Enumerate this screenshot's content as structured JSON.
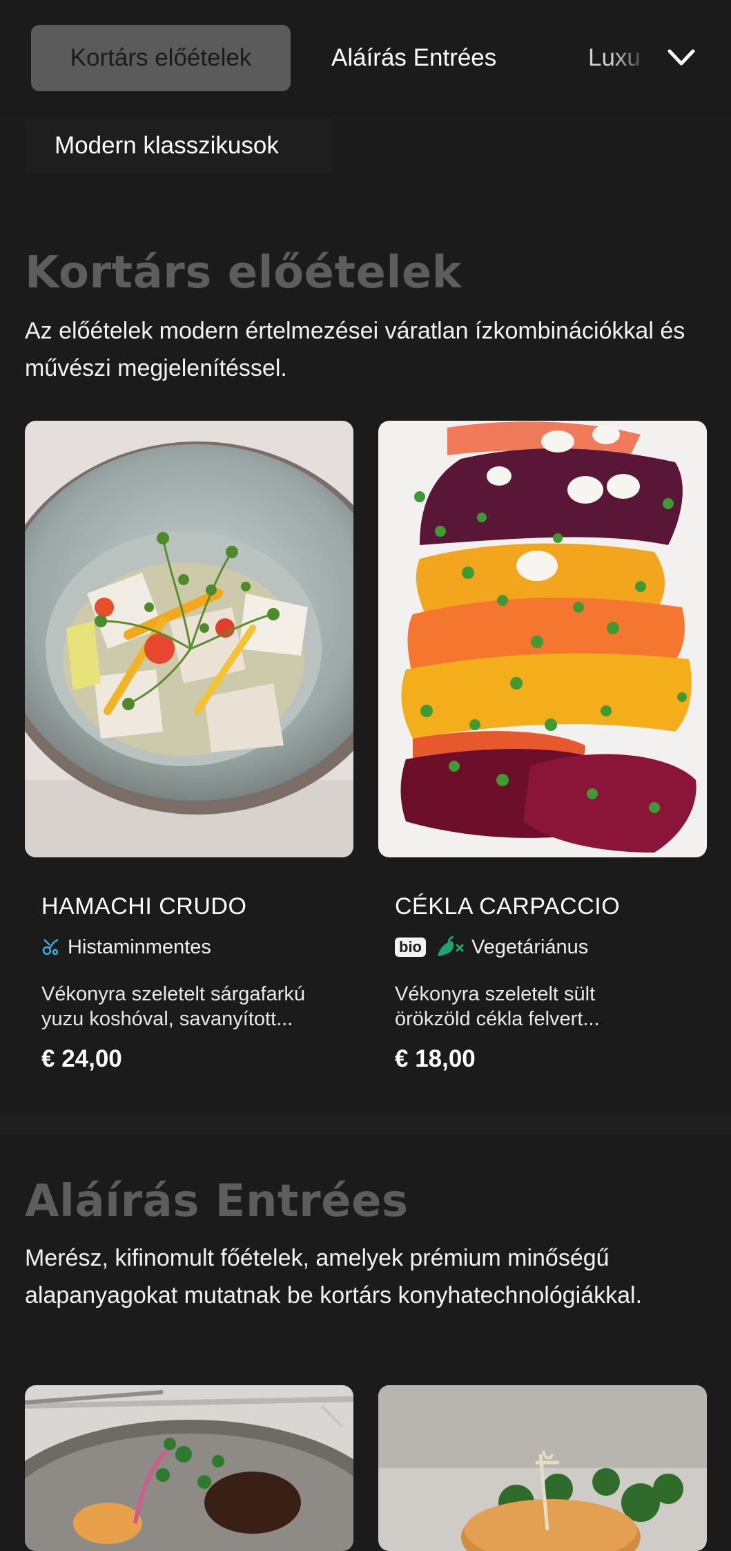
{
  "nav": {
    "tabs": [
      "Kortárs előételek",
      "Aláírás Entrées",
      "Luxu"
    ],
    "subtab": "Modern klasszikusok",
    "expand_icon": "chevron-down-icon"
  },
  "sections": [
    {
      "title": "Kortárs előételek",
      "description": "Az előételek modern értelmezései váratlan ízkombinációkkal és művészi megjelenítéssel.",
      "items": [
        {
          "name": "HAMACHI CRUDO",
          "tag": "Histaminmentes",
          "tag_icon": "histamine-free-icon",
          "description_line1": "Vékonyra szeletelt sárgafarkú",
          "description_line2": "yuzu koshóval, savanyított...",
          "price": "€ 24,00"
        },
        {
          "name": "CÉKLA CARPACCIO",
          "badge": "bio",
          "tag": "Vegetáriánus",
          "tag_icon": "vegetarian-icon",
          "description_line1": "Vékonyra szeletelt sült",
          "description_line2": "örökzöld cékla felvert...",
          "price": "€ 18,00"
        }
      ]
    },
    {
      "title": "Aláírás Entrées",
      "description": "Merész, kifinomult főételek, amelyek prémium minőségű alapanyagokat mutatnak be kortárs konyhatechnológiákkal."
    }
  ],
  "colors": {
    "background": "#1b1b1b",
    "active_tab": "#5b5b5b",
    "section_title": "#5d5d5d",
    "vegan_green": "#1aa86b",
    "histamine_blue": "#3ab0e6"
  }
}
